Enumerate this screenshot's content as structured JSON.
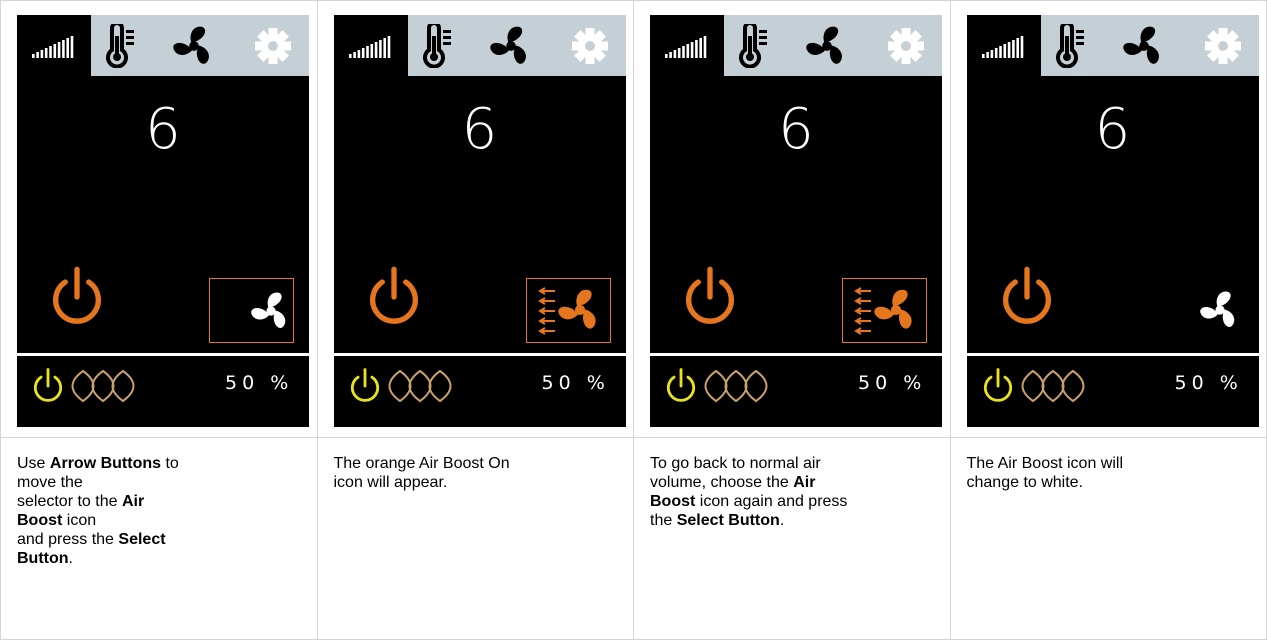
{
  "panels": [
    {
      "level": "6",
      "percent": "50 %",
      "boost_state": "white-framed",
      "instruction": [
        {
          "t": "Use ",
          "b": false
        },
        {
          "t": "Arrow Buttons",
          "b": true
        },
        {
          "t": " to",
          "b": false
        },
        {
          "t": "\n",
          "b": false
        },
        {
          "t": "move the",
          "b": false
        },
        {
          "t": "\n",
          "b": false
        },
        {
          "t": "selector to the ",
          "b": false
        },
        {
          "t": "Air",
          "b": true
        },
        {
          "t": "\n",
          "b": false
        },
        {
          "t": "Boost",
          "b": true
        },
        {
          "t": " icon",
          "b": false
        },
        {
          "t": "\n",
          "b": false
        },
        {
          "t": "and press the ",
          "b": false
        },
        {
          "t": "Select",
          "b": true
        },
        {
          "t": "\n",
          "b": false
        },
        {
          "t": "Button",
          "b": true
        },
        {
          "t": ".",
          "b": false
        }
      ]
    },
    {
      "level": "6",
      "percent": "50 %",
      "boost_state": "orange-framed",
      "instruction": [
        {
          "t": "The orange Air Boost On",
          "b": false
        },
        {
          "t": "\n",
          "b": false
        },
        {
          "t": "icon will appear.",
          "b": false
        }
      ]
    },
    {
      "level": "6",
      "percent": "50 %",
      "boost_state": "orange-framed",
      "instruction": [
        {
          "t": "To go back to normal air",
          "b": false
        },
        {
          "t": "\n",
          "b": false
        },
        {
          "t": "volume, choose the ",
          "b": false
        },
        {
          "t": "Air",
          "b": true
        },
        {
          "t": "\n",
          "b": false
        },
        {
          "t": "Boost",
          "b": true
        },
        {
          "t": " icon again and press",
          "b": false
        },
        {
          "t": "\n",
          "b": false
        },
        {
          "t": "the ",
          "b": false
        },
        {
          "t": "Select Button",
          "b": true
        },
        {
          "t": ".",
          "b": false
        }
      ]
    },
    {
      "level": "6",
      "percent": "50 %",
      "boost_state": "white-plain",
      "instruction": [
        {
          "t": "The Air Boost icon will",
          "b": false
        },
        {
          "t": "\n",
          "b": false
        },
        {
          "t": "change to white.",
          "b": false
        }
      ]
    }
  ],
  "tabs": [
    "signal-bars-icon",
    "thermometer-icon",
    "fan-icon",
    "gear-icon"
  ],
  "colors": {
    "tab_bar": "#c5d0d6",
    "screen_bg": "#000000",
    "accent_orange": "#e5761d",
    "status_yellow": "#e6e21c",
    "leaf_tan": "#c9a070",
    "white": "#ffffff"
  }
}
